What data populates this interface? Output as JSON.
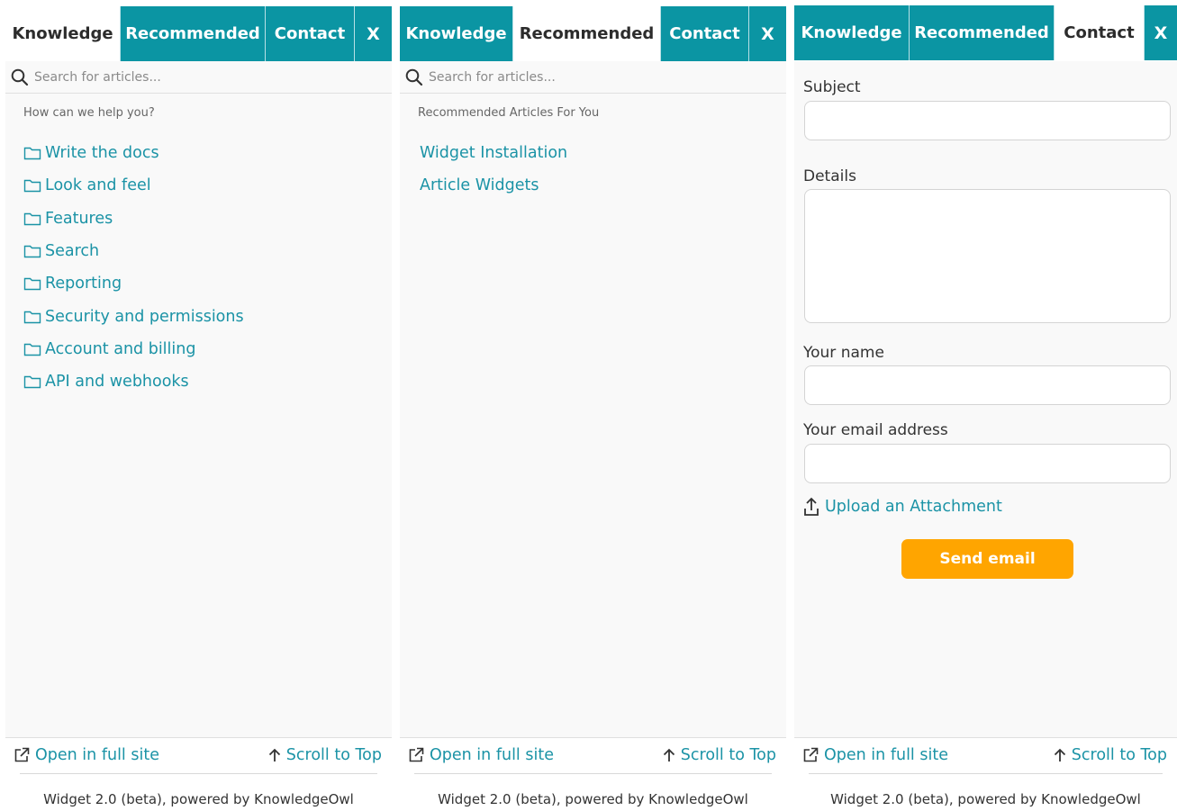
{
  "tabs": {
    "knowledge": "Knowledge",
    "recommended": "Recommended",
    "contact": "Contact",
    "close": "X"
  },
  "search": {
    "placeholder": "Search for articles..."
  },
  "knowledge_panel": {
    "heading": "How can we help you?",
    "categories": [
      "Write the docs",
      "Look and feel",
      "Features",
      "Search",
      "Reporting",
      "Security and permissions",
      "Account and billing",
      "API and webhooks"
    ]
  },
  "recommended_panel": {
    "heading": "Recommended Articles For You",
    "articles": [
      "Widget Installation",
      "Article Widgets"
    ]
  },
  "contact_panel": {
    "subject_label": "Subject",
    "details_label": "Details",
    "name_label": "Your name",
    "email_label": "Your email address",
    "upload_label": "Upload an Attachment",
    "send_label": "Send email"
  },
  "footer": {
    "open_full_site": "Open in full site",
    "scroll_to_top": "Scroll to Top",
    "powered_by": "Widget 2.0 (beta), powered by KnowledgeOwl"
  },
  "colors": {
    "accent": "#0b95a3",
    "link": "#1b93a6",
    "button": "#ffa500",
    "panel_bg": "#f9f9f9"
  },
  "icons": {
    "search": "search-icon",
    "folder": "folder-icon",
    "external": "external-link-icon",
    "arrow_up": "arrow-up-icon",
    "upload": "upload-icon"
  }
}
